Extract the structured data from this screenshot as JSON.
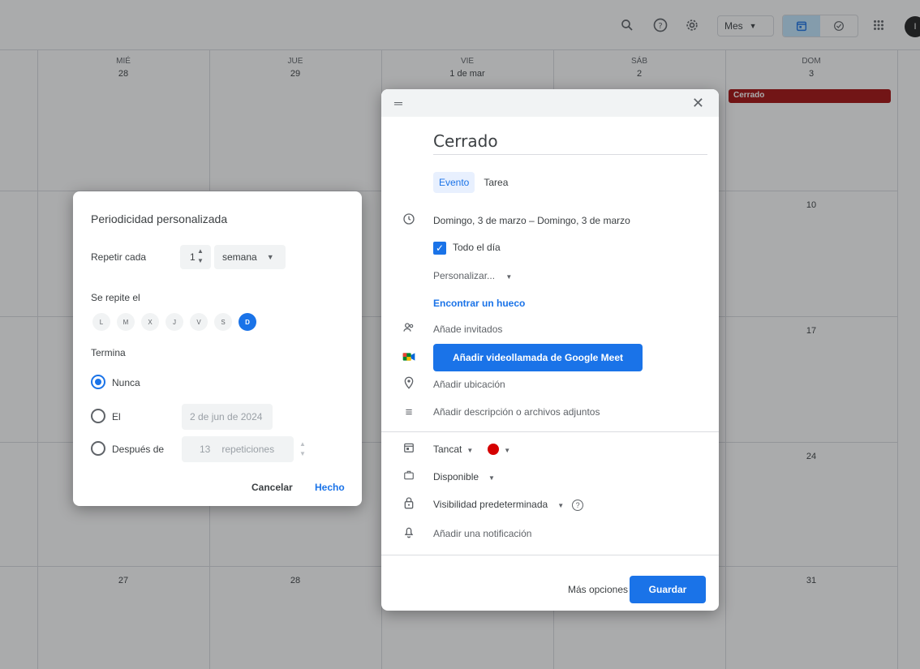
{
  "topbar": {
    "view": "Mes",
    "avatar_letter": "I"
  },
  "calendar": {
    "headers": [
      {
        "name": "MIÉ",
        "num": "28"
      },
      {
        "name": "JUE",
        "num": "29"
      },
      {
        "name": "VIE",
        "num": "1 de mar"
      },
      {
        "name": "SÁB",
        "num": "2"
      },
      {
        "name": "DOM",
        "num": "3"
      }
    ],
    "week_numbers": [
      "10",
      "17",
      "24",
      "31"
    ],
    "last_row": [
      "27",
      "28"
    ],
    "event_chip": "Cerrado"
  },
  "editor": {
    "title": "Cerrado",
    "tabs": [
      "Evento",
      "Tarea"
    ],
    "date_range": "Domingo, 3 de marzo  –  Domingo, 3 de marzo",
    "all_day": "Todo el día",
    "customize": "Personalizar...",
    "find_slot": "Encontrar un hueco",
    "guests": "Añade invitados",
    "meet": "Añadir videollamada de Google Meet",
    "location": "Añadir ubicación",
    "description": "Añadir descripción o archivos adjuntos",
    "calendar_name": "Tancat",
    "event_color": "#d50000",
    "availability": "Disponible",
    "visibility": "Visibilidad predeterminada",
    "notification": "Añadir una notificación",
    "more_options": "Más opciones",
    "save": "Guardar"
  },
  "recurrence": {
    "title": "Periodicidad personalizada",
    "repeat_every": "Repetir cada",
    "interval": "1",
    "unit": "semana",
    "repeats_on": "Se repite el",
    "days": [
      "L",
      "M",
      "X",
      "J",
      "V",
      "S",
      "D"
    ],
    "selected_day": "D",
    "ends": "Termina",
    "never": "Nunca",
    "on": "El",
    "on_date": "2 de jun de 2024",
    "after": "Después de",
    "after_count": "13",
    "after_unit": "repeticiones",
    "cancel": "Cancelar",
    "done": "Hecho"
  },
  "colors": {
    "accent": "#1a73e8",
    "event_red": "#a50e0e"
  }
}
